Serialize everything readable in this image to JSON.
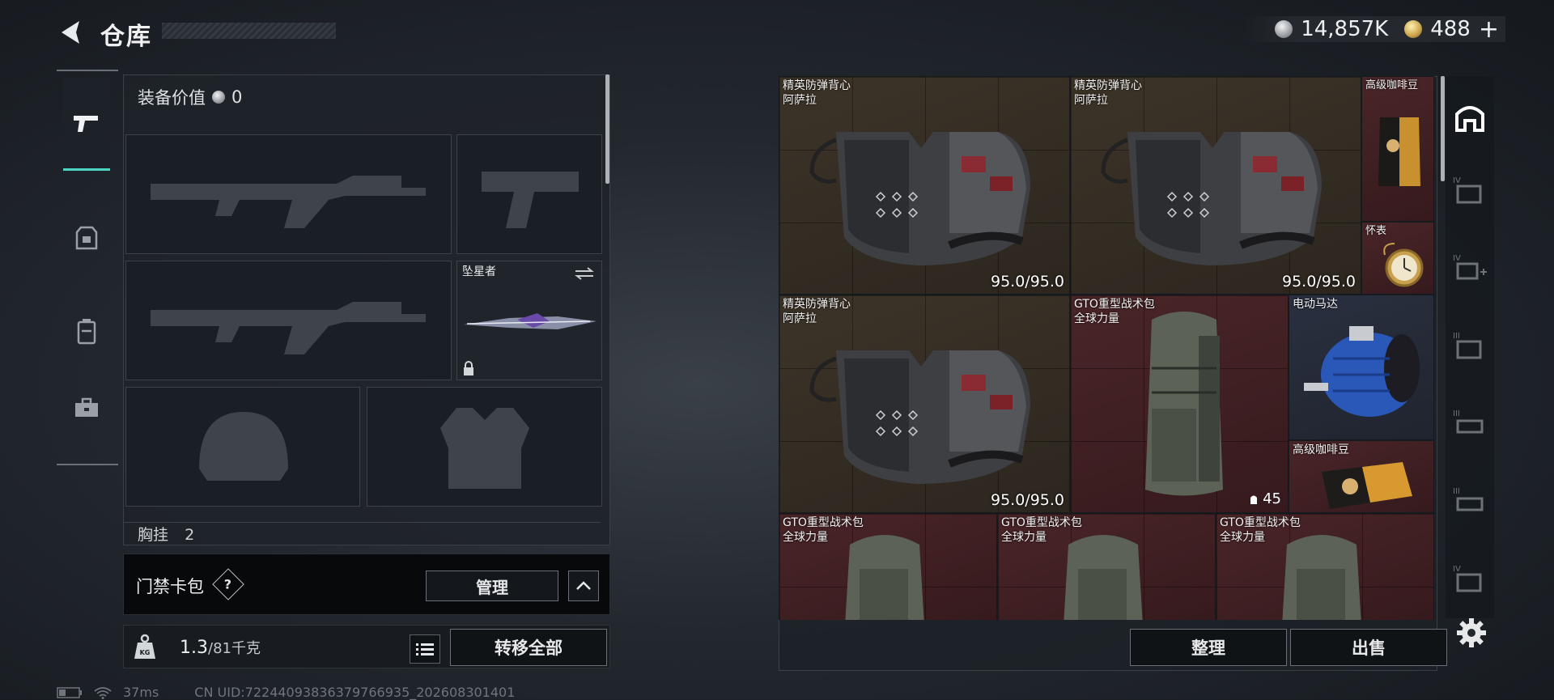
{
  "header": {
    "title": "仓库"
  },
  "currency": {
    "silver": "14,857K",
    "gold": "488",
    "add_label": "+"
  },
  "loadout": {
    "equipment_value_label": "装备价值",
    "equipment_value": "0",
    "melee_name": "坠星者",
    "chest_rig_label": "胸挂",
    "chest_rig_count": "2"
  },
  "keycard": {
    "label": "门禁卡包",
    "help": "?",
    "manage": "管理"
  },
  "weight": {
    "current": "1.3",
    "max": "/81千克",
    "icon_text": "KG"
  },
  "actions": {
    "transfer_all": "转移全部",
    "sort": "整理",
    "sell": "出售"
  },
  "status": {
    "ping": "37ms",
    "uid": "CN UID:72244093836379766935_202608301401"
  },
  "stash": {
    "items": [
      {
        "name": "精英防弹背心",
        "sub": "阿萨拉",
        "durability": "95.0/95.0"
      },
      {
        "name": "精英防弹背心",
        "sub": "阿萨拉",
        "durability": "95.0/95.0"
      },
      {
        "name": "高级咖啡豆",
        "sub": ""
      },
      {
        "name": "怀表",
        "sub": ""
      },
      {
        "name": "精英防弹背心",
        "sub": "阿萨拉",
        "durability": "95.0/95.0"
      },
      {
        "name": "GTO重型战术包",
        "sub": "全球力量",
        "count": "45"
      },
      {
        "name": "电动马达",
        "sub": ""
      },
      {
        "name": "高级咖啡豆",
        "sub": ""
      },
      {
        "name": "GTO重型战术包",
        "sub": "全球力量"
      },
      {
        "name": "GTO重型战术包",
        "sub": "全球力量"
      },
      {
        "name": "GTO重型战术包",
        "sub": "全球力量"
      }
    ]
  },
  "rail": {
    "tiers": [
      "IV",
      "IV",
      "III",
      "III",
      "III",
      "IV"
    ]
  },
  "colors": {
    "accent": "#4ad6c0",
    "rare_red": "#4a2528",
    "epic_brown": "#3d3428",
    "blue": "#2a3040"
  },
  "icons": [
    "back-arrow-icon",
    "pistol-icon",
    "armor-icon",
    "backpack-icon",
    "toolbox-icon",
    "silver-coin-icon",
    "gold-coin-icon",
    "swap-icon",
    "lock-icon",
    "question-icon",
    "chevron-up-icon",
    "weight-icon",
    "list-icon",
    "stash-home-icon",
    "settings-gear-icon",
    "wifi-icon",
    "battery-icon"
  ]
}
